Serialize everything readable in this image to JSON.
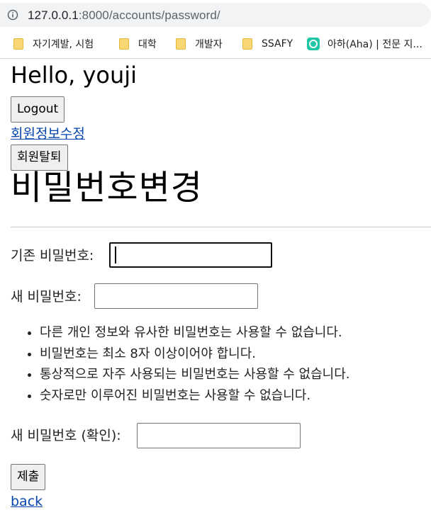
{
  "browser": {
    "url_host": "127.0.0.1",
    "url_path": ":8000/accounts/password/",
    "bookmarks": [
      {
        "label": "자기계발, 시험",
        "icon": "folder-icon"
      },
      {
        "label": "대학",
        "icon": "folder-icon"
      },
      {
        "label": "개발자",
        "icon": "folder-icon"
      },
      {
        "label": "SSAFY",
        "icon": "folder-icon"
      },
      {
        "label": "아하(Aha) | 전문 지...",
        "icon": "aha-icon"
      }
    ]
  },
  "header": {
    "greeting": "Hello, youji",
    "logout_label": "Logout",
    "edit_profile_link": "회원정보수정",
    "delete_account_label": "회원탈퇴"
  },
  "main": {
    "title": "비밀번호변경",
    "form": {
      "old_password_label": "기존 비밀번호:",
      "old_password_value": "",
      "new_password_label": "새 비밀번호:",
      "new_password_value": "",
      "help_items": [
        "다른 개인 정보와 유사한 비밀번호는 사용할 수 없습니다.",
        "비밀번호는 최소 8자 이상이어야 합니다.",
        "통상적으로 자주 사용되는 비밀번호는 사용할 수 없습니다.",
        "숫자로만 이루어진 비밀번호는 사용할 수 없습니다."
      ],
      "confirm_password_label": "새 비밀번호 (확인):",
      "confirm_password_value": "",
      "submit_label": "제출"
    },
    "back_link": "back"
  },
  "colors": {
    "link": "#0645ad",
    "address_bar_bg": "#f1f3f4",
    "folder": "#f8d774",
    "aha_brand": "#1fc8a5"
  }
}
